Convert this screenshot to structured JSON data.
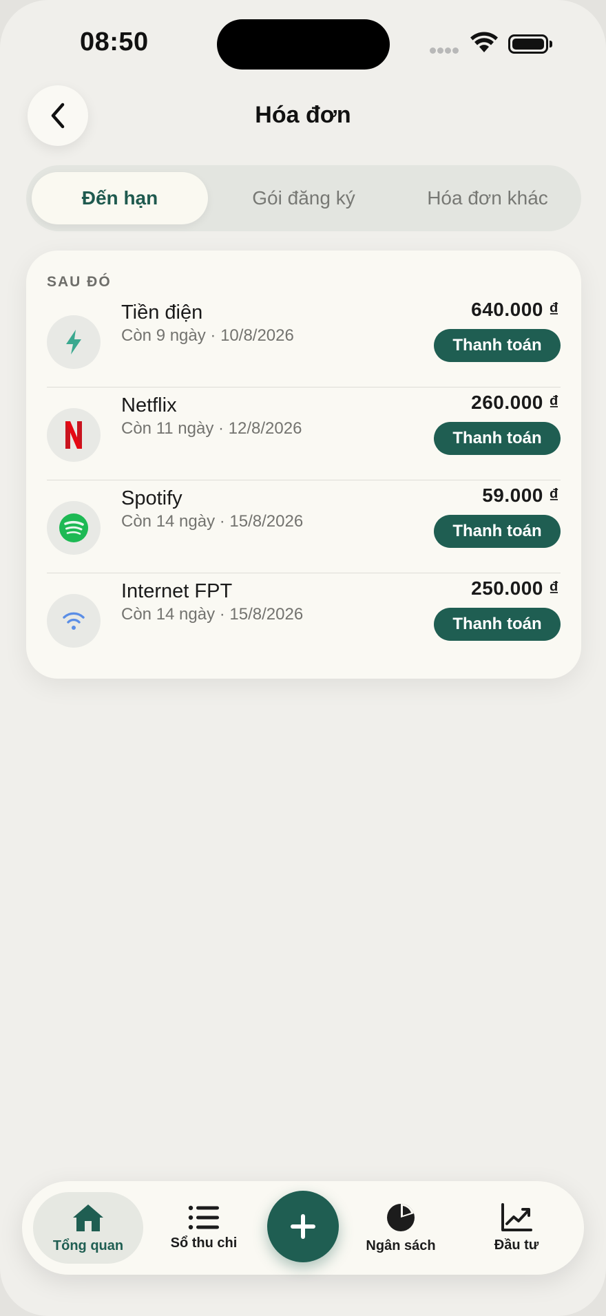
{
  "status_bar": {
    "time": "08:50"
  },
  "header": {
    "title": "Hóa đơn"
  },
  "tabs": [
    {
      "label": "Đến hạn",
      "active": true
    },
    {
      "label": "Gói đăng ký",
      "active": false
    },
    {
      "label": "Hóa đơn khác",
      "active": false
    }
  ],
  "section": {
    "label": "SAU ĐÓ"
  },
  "bills": [
    {
      "name": "Tiền điện",
      "subtitle": "Còn 9 ngày · 10/8/2026",
      "amount": "640.000 ₫",
      "action": "Thanh toán",
      "icon": "lightning-icon"
    },
    {
      "name": "Netflix",
      "subtitle": "Còn 11 ngày · 12/8/2026",
      "amount": "260.000 ₫",
      "action": "Thanh toán",
      "icon": "netflix-icon"
    },
    {
      "name": "Spotify",
      "subtitle": "Còn 14 ngày · 15/8/2026",
      "amount": "59.000 ₫",
      "action": "Thanh toán",
      "icon": "spotify-icon"
    },
    {
      "name": "Internet FPT",
      "subtitle": "Còn 14 ngày · 15/8/2026",
      "amount": "250.000 ₫",
      "action": "Thanh toán",
      "icon": "wifi-icon"
    }
  ],
  "nav": {
    "items": [
      {
        "label": "Tổng quan",
        "icon": "home-icon",
        "active": true
      },
      {
        "label": "Sổ thu chi",
        "icon": "list-icon",
        "active": false
      },
      {
        "label": "Ngân sách",
        "icon": "pie-chart-icon",
        "active": false
      },
      {
        "label": "Đầu tư",
        "icon": "trend-chart-icon",
        "active": false
      }
    ],
    "fab_icon": "plus-icon"
  },
  "colors": {
    "accent": "#1f5e52",
    "background": "#f0efeb",
    "card": "#faf9f3"
  }
}
